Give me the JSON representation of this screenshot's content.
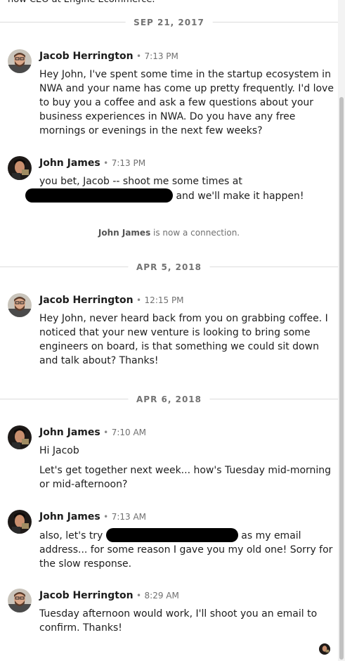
{
  "top_partial_text": "now CEO at Engine Ecommerce.",
  "dates": {
    "d1": "SEP 21, 2017",
    "d2": "APR 5, 2018",
    "d3": "APR 6, 2018"
  },
  "messages": [
    {
      "sender": "Jacob Herrington",
      "time": "7:13 PM",
      "body": "Hey John, I've spent some time in the startup ecosystem in NWA and your name has come up pretty frequently. I'd love to buy you a coffee and ask a few questions about your business experiences in NWA. Do you have any free mornings or evenings in the next few weeks?"
    },
    {
      "sender": "John James",
      "time": "7:13 PM",
      "body_part1": "you bet, Jacob -- shoot me some times at",
      "body_part2": "and we'll make it happen!"
    },
    {
      "sender": "Jacob Herrington",
      "time": "12:15 PM",
      "body": "Hey John, never heard back from you on grabbing coffee. I noticed that your new venture is looking to bring some engineers on board, is that something we could sit down and talk about? Thanks!"
    },
    {
      "sender": "John James",
      "time": "7:10 AM",
      "body_p1": "Hi Jacob",
      "body_p2": "Let's get together next week... how's Tuesday mid-morning or mid-afternoon?"
    },
    {
      "sender": "John James",
      "time": "7:13 AM",
      "body_part1": "also, let's try",
      "body_part2": "as my email address... for some reason I gave you my old one! Sorry for the slow response."
    },
    {
      "sender": "Jacob Herrington",
      "time": "8:29 AM",
      "body": "Tuesday afternoon would work, I'll shoot you an email to confirm. Thanks!"
    }
  ],
  "system_note": {
    "name": "John James",
    "text": " is now a connection."
  },
  "separator_dot": "•",
  "colors": {
    "redaction": "#000000",
    "divider": "#dcdcdc",
    "timestamp": "#707070"
  }
}
